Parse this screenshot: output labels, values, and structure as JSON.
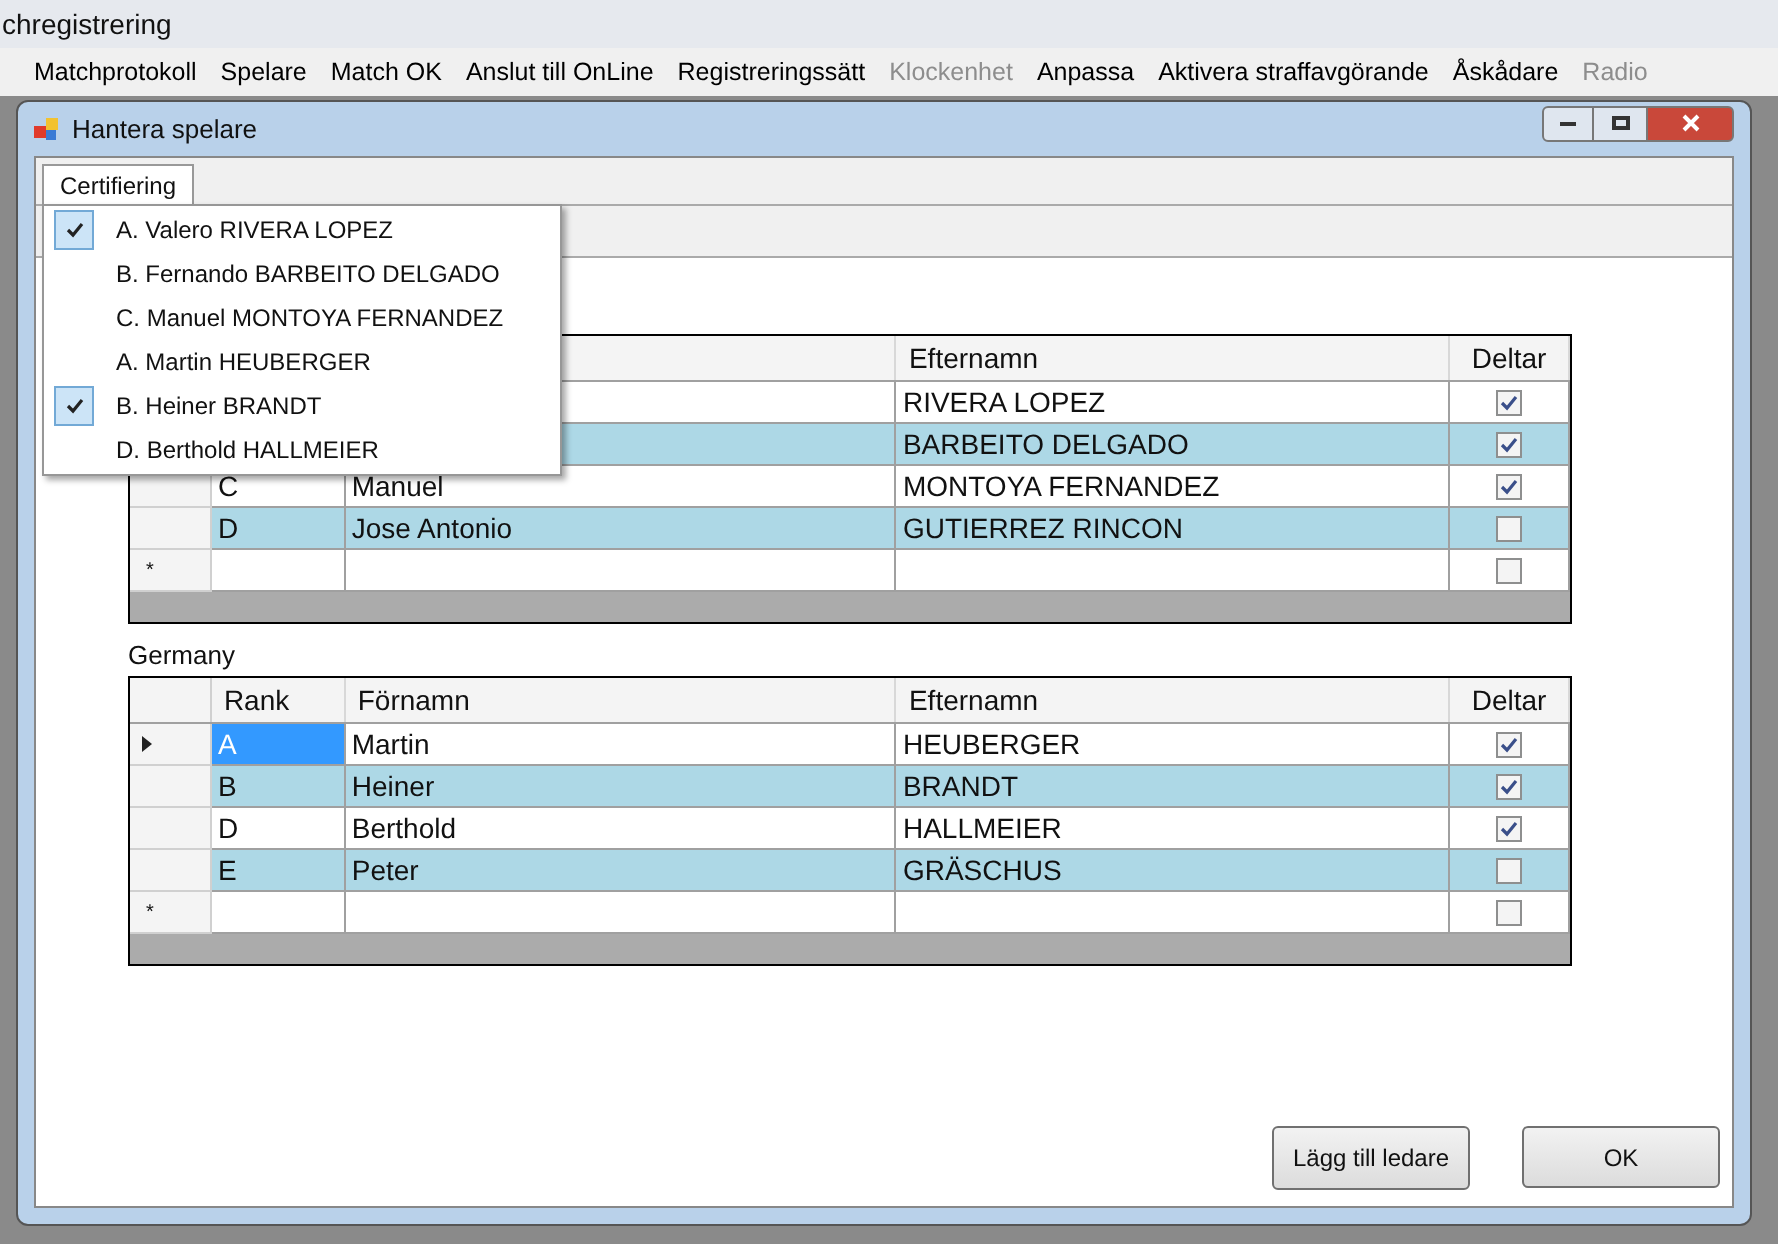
{
  "app": {
    "title": "chregistrering"
  },
  "menu": [
    {
      "label": "Matchprotokoll",
      "disabled": false
    },
    {
      "label": "Spelare",
      "disabled": false
    },
    {
      "label": "Match OK",
      "disabled": false
    },
    {
      "label": "Anslut till OnLine",
      "disabled": false
    },
    {
      "label": "Registreringssätt",
      "disabled": false
    },
    {
      "label": "Klockenhet",
      "disabled": true
    },
    {
      "label": "Anpassa",
      "disabled": false
    },
    {
      "label": "Aktivera straffavgörande",
      "disabled": false
    },
    {
      "label": "Åskådare",
      "disabled": false
    },
    {
      "label": "Radio",
      "disabled": true
    }
  ],
  "dialog": {
    "title": "Hantera spelare",
    "tabs": [
      {
        "label": "Certifiering",
        "selected": true
      }
    ],
    "dropdown": [
      {
        "label": "A. Valero RIVERA LOPEZ",
        "checked": true
      },
      {
        "label": "B. Fernando BARBEITO DELGADO",
        "checked": false
      },
      {
        "label": "C. Manuel MONTOYA FERNANDEZ",
        "checked": false
      },
      {
        "label": "A. Martin HEUBERGER",
        "checked": false
      },
      {
        "label": "B. Heiner BRANDT",
        "checked": true
      },
      {
        "label": "D. Berthold HALLMEIER",
        "checked": false
      }
    ],
    "teams": [
      {
        "columns": [
          {},
          {},
          {
            "label": "Efternamn"
          },
          {
            "label": "Deltar"
          }
        ],
        "rows": [
          {
            "last_name": "RIVERA LOPEZ",
            "deltar": true
          },
          {
            "last_name": "BARBEITO DELGADO",
            "deltar": true
          },
          {
            "rank": "C",
            "first_name": "Manuel",
            "last_name": "MONTOYA FERNANDEZ",
            "deltar": true,
            "current": false
          },
          {
            "rank": "D",
            "first_name": "Jose Antonio",
            "last_name": "GUTIERREZ RINCON",
            "deltar": false,
            "current": false
          }
        ],
        "new_row": {
          "marker": "*",
          "deltar": false
        }
      },
      {
        "name": "Germany",
        "columns": [
          {
            "label": "Rank"
          },
          {
            "label": "Förnamn"
          },
          {
            "label": "Efternamn"
          },
          {
            "label": "Deltar"
          }
        ],
        "rows": [
          {
            "rank": "A",
            "first_name": "Martin",
            "last_name": "HEUBERGER",
            "deltar": true,
            "current": true
          },
          {
            "rank": "B",
            "first_name": "Heiner",
            "last_name": "BRANDT",
            "deltar": true,
            "current": false
          },
          {
            "rank": "D",
            "first_name": "Berthold",
            "last_name": "HALLMEIER",
            "deltar": true,
            "current": false
          },
          {
            "rank": "E",
            "first_name": "Peter",
            "last_name": "GRÄSCHUS",
            "deltar": false,
            "current": false
          }
        ],
        "new_row": {
          "marker": "*",
          "deltar": false
        }
      }
    ],
    "buttons": [
      "Lägg till ledare",
      "OK"
    ]
  }
}
